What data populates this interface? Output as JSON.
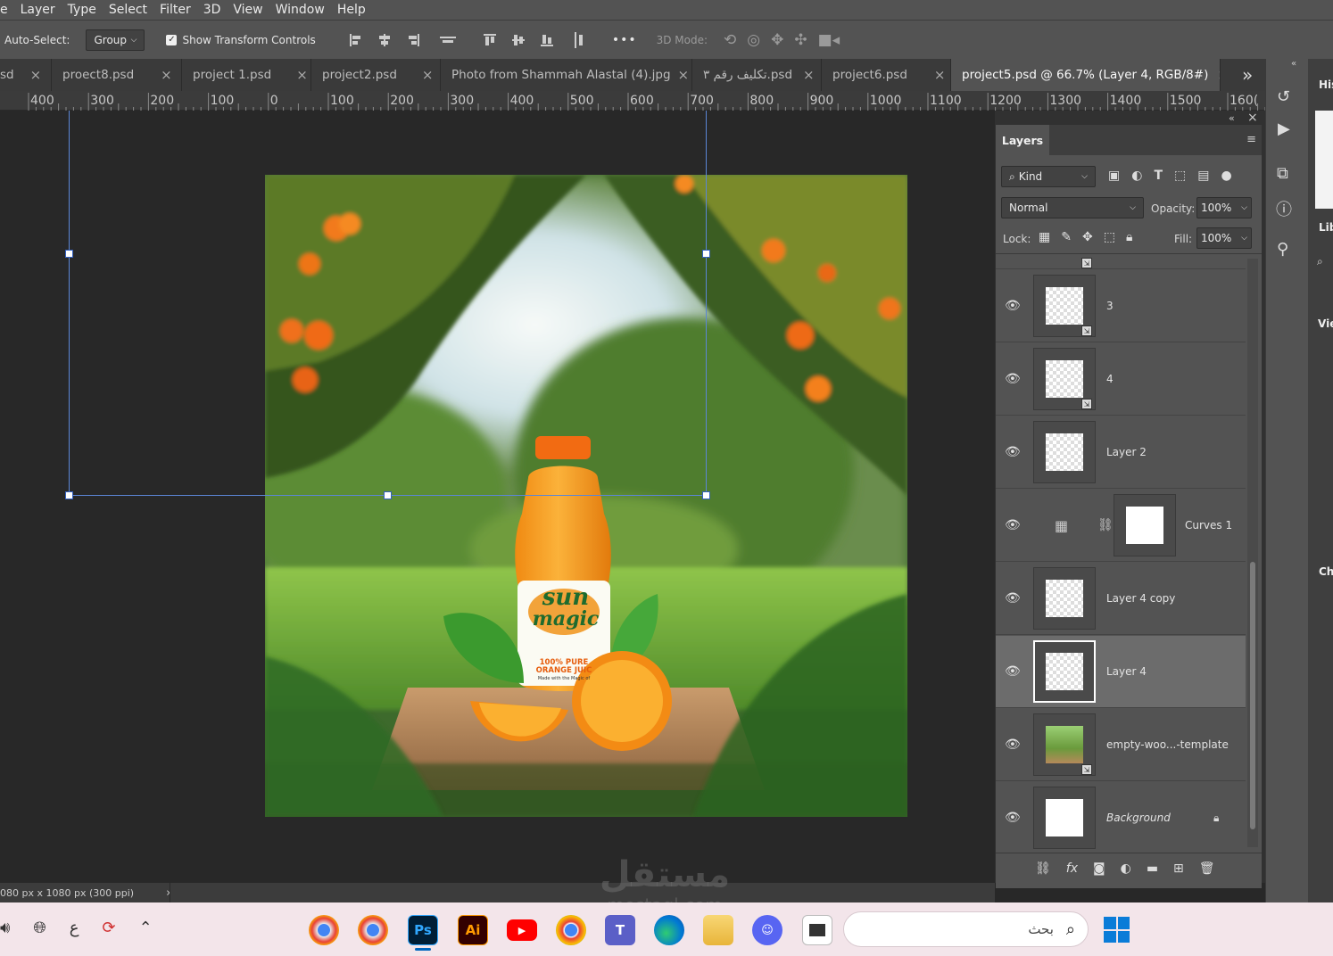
{
  "menu": {
    "items": [
      "e",
      "Layer",
      "Type",
      "Select",
      "Filter",
      "3D",
      "View",
      "Window",
      "Help"
    ]
  },
  "options": {
    "auto_select_label": "Auto-Select:",
    "auto_select_value": "Group",
    "show_transform_label": "Show Transform Controls",
    "more_label": "•••",
    "mode_label": "3D Mode:"
  },
  "tabs": [
    {
      "label": "sd"
    },
    {
      "label": "proect8.psd"
    },
    {
      "label": "project 1.psd"
    },
    {
      "label": "project2.psd"
    },
    {
      "label": "Photo from Shammah Alastal (4).jpg"
    },
    {
      "label": "تكليف رقم ٣.psd"
    },
    {
      "label": "project6.psd"
    },
    {
      "label": "project5.psd @ 66.7% (Layer 4, RGB/8#)"
    }
  ],
  "tabs_overflow": "»",
  "ruler": {
    "ticks": [
      "400",
      "300",
      "200",
      "100",
      "0",
      "100",
      "200",
      "300",
      "400",
      "500",
      "600",
      "700",
      "800",
      "900",
      "1000",
      "1100",
      "1200",
      "1300",
      "1400",
      "1500",
      "160("
    ]
  },
  "status": {
    "doc_info": "080 px x 1080 px (300 ppi)",
    "arrow": "›"
  },
  "layers_panel": {
    "title": "Layers",
    "filter_kind": "Kind",
    "blend_mode": "Normal",
    "opacity_label": "Opacity:",
    "opacity_value": "100%",
    "lock_label": "Lock:",
    "fill_label": "Fill:",
    "fill_value": "100%",
    "layers": [
      {
        "name": "3",
        "kind": "smart"
      },
      {
        "name": "4",
        "kind": "smart"
      },
      {
        "name": "Layer 2",
        "kind": "pixel"
      },
      {
        "name": "Curves 1",
        "kind": "adjustment"
      },
      {
        "name": "Layer 4 copy",
        "kind": "pixel"
      },
      {
        "name": "Layer 4",
        "kind": "pixel",
        "selected": true
      },
      {
        "name": "empty-woo...-template",
        "kind": "smart"
      },
      {
        "name": "Background",
        "kind": "background"
      }
    ],
    "footer_icons": [
      "link-icon",
      "fx-icon",
      "mask-icon",
      "adjustment-icon",
      "folder-icon",
      "new-layer-icon",
      "trash-icon"
    ]
  },
  "right_panels": {
    "histogram_label": "His",
    "libraries_label": "Lib",
    "view_label": "Vie",
    "channels_label": "Ch"
  },
  "artwork": {
    "brand_line1": "sun",
    "brand_line2": "magic",
    "label_line1": "100% PURE",
    "label_line2": "ORANGE JUIC",
    "label_line3": "Made with the Magic of"
  },
  "watermark": {
    "arabic": "مستقل",
    "latin": "mostaql.com"
  },
  "taskbar": {
    "search_placeholder": "بحث",
    "lang": "ع",
    "apps": [
      "chrome-profile-1",
      "chrome-profile-2",
      "photoshop",
      "illustrator",
      "youtube",
      "chrome",
      "teams",
      "edge",
      "file-explorer",
      "discord",
      "app-window"
    ],
    "ps_label": "Ps",
    "ai_label": "Ai"
  },
  "colors": {
    "ui_bg": "#535353",
    "canvas_bg": "#282828",
    "accent": "#4a6fc7",
    "orange": "#f59a1b"
  }
}
